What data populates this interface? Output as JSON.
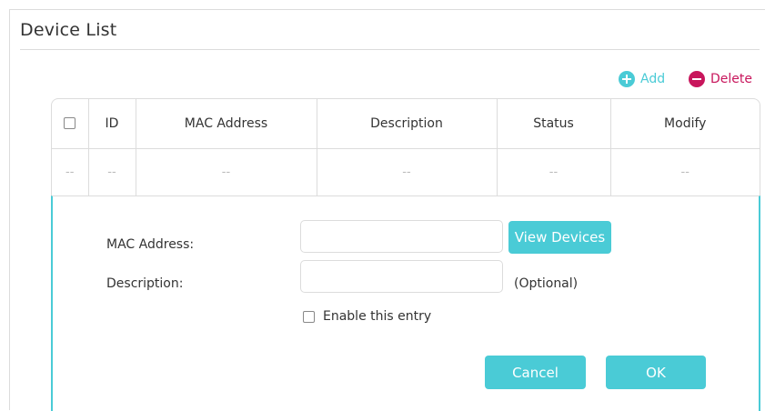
{
  "page": {
    "title": "Device List"
  },
  "toolbar": {
    "add_label": "Add",
    "delete_label": "Delete",
    "add_icon": "plus-circle-icon",
    "delete_icon": "minus-circle-icon"
  },
  "table": {
    "columns": [
      "ID",
      "MAC Address",
      "Description",
      "Status",
      "Modify"
    ],
    "rows": [
      {
        "checkbox": "--",
        "id": "--",
        "mac": "--",
        "description": "--",
        "status": "--",
        "modify": "--"
      }
    ]
  },
  "form": {
    "mac_label": "MAC Address:",
    "mac_value": "",
    "view_devices_label": "View Devices",
    "description_label": "Description:",
    "description_value": "",
    "optional_note": "(Optional)",
    "enable_label": "Enable this entry",
    "enable_checked": false,
    "cancel_label": "Cancel",
    "ok_label": "OK"
  },
  "colors": {
    "accent": "#4acbd6",
    "delete": "#c8165c",
    "border": "#dcdcdc"
  }
}
